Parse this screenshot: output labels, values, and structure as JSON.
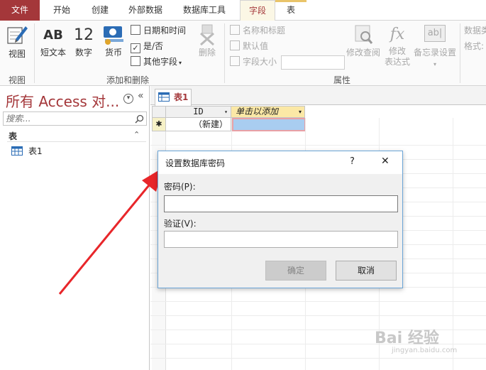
{
  "ribbon_tabs": {
    "file": "文件",
    "home": "开始",
    "create": "创建",
    "external": "外部数据",
    "dbtools": "数据库工具",
    "fields": "字段",
    "table": "表"
  },
  "ribbon": {
    "view_btn": "视图",
    "view_group": "视图",
    "short_text": "短文本",
    "number_icon_text": "12",
    "number": "数字",
    "ab_icon_text": "AB",
    "currency": "货币",
    "datetime": "日期和时间",
    "yesno": "是/否",
    "more_fields": "其他字段",
    "delete": "删除",
    "add_delete_group": "添加和删除",
    "name_caption": "名称和标题",
    "default_value": "默认值",
    "field_size": "字段大小",
    "modify_lookups": "修改查阅",
    "modify_expression": "修改\n表达式",
    "fx_icon_text": "fx",
    "ab_box_icon_text": "ab|",
    "memo_settings": "备忘录设置",
    "properties_group": "属性",
    "data_type_cut": "数据类",
    "format_cut": "格式:"
  },
  "nav": {
    "title": "所有 Access 对...",
    "search_placeholder": "搜索...",
    "section": "表",
    "item": "表1"
  },
  "datasheet": {
    "tab": "表1",
    "col_id": "ID",
    "col_add": "单击以添加",
    "row_marker": "✱",
    "new_row": "（新建）"
  },
  "dialog": {
    "title": "设置数据库密码",
    "help": "?",
    "close": "✕",
    "password_label": "密码(P):",
    "password_value": "",
    "verify_label": "验证(V):",
    "verify_value": "",
    "ok": "确定",
    "cancel": "取消"
  },
  "watermark": {
    "brand": "Bai 经验",
    "url": "jingyan.baidu.com"
  },
  "colors": {
    "access_red": "#a4373a",
    "selection_blue": "#a9cdf0",
    "arrow_red": "#e8262a"
  }
}
